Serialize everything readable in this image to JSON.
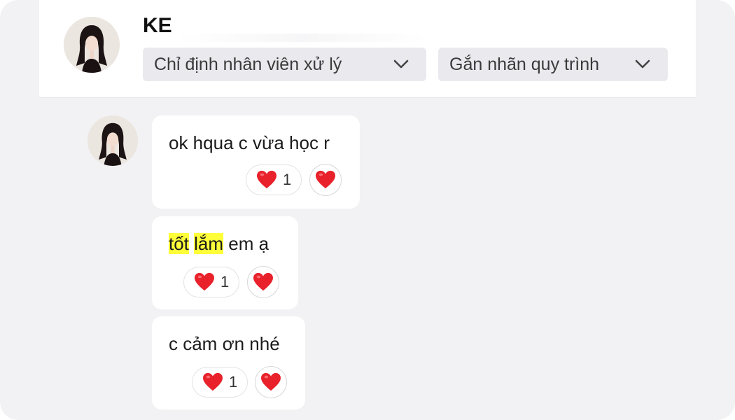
{
  "header": {
    "contact_name": "KE",
    "assign_dropdown": "Chỉ định nhân viên xử lý",
    "label_dropdown": "Gắn nhãn quy trình"
  },
  "messages": [
    {
      "text": "ok hqua c vừa học r",
      "reaction_count": "1"
    },
    {
      "parts": [
        "tốt",
        " ",
        "lắm",
        " em ạ"
      ],
      "reaction_count": "1"
    },
    {
      "text": "c cảm ơn nhé",
      "reaction_count": "1"
    }
  ],
  "icons": {
    "reaction": "heart-icon",
    "add_reaction": "heart-icon",
    "dropdown": "chevron-down-icon"
  },
  "colors": {
    "highlight": "#ffff3a",
    "heart": "#e8212b",
    "background": "#f2f2f4"
  }
}
